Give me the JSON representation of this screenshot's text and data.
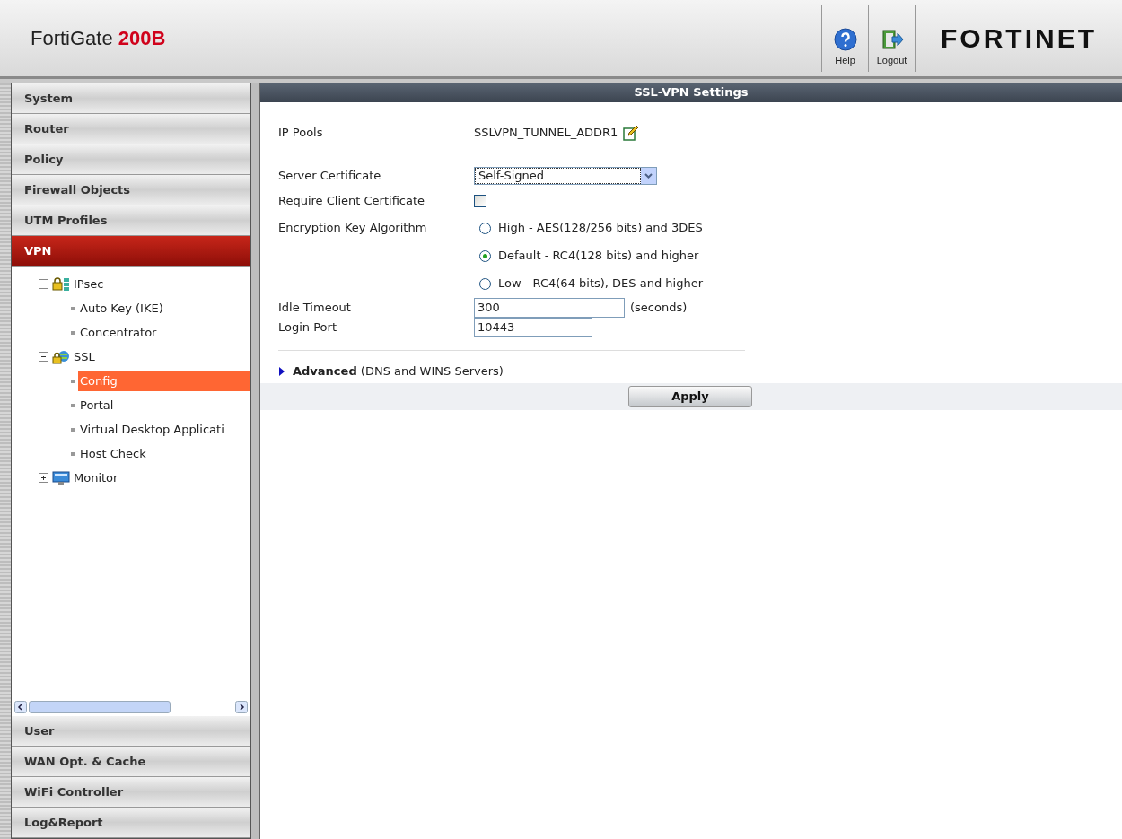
{
  "header": {
    "product": "FortiGate",
    "model": "200B",
    "buttons": [
      {
        "kind": "help",
        "label": "Help"
      },
      {
        "kind": "logout",
        "label": "Logout"
      }
    ],
    "logo": "FORTINET"
  },
  "sidebar": {
    "top_items": [
      {
        "label": "System",
        "selected": false
      },
      {
        "label": "Router",
        "selected": false
      },
      {
        "label": "Policy",
        "selected": false
      },
      {
        "label": "Firewall Objects",
        "selected": false
      },
      {
        "label": "UTM Profiles",
        "selected": false
      },
      {
        "label": "VPN",
        "selected": true
      }
    ],
    "tree": [
      {
        "label": "IPsec",
        "kind": "ipsec",
        "expanded": true,
        "children": [
          {
            "label": "Auto Key (IKE)",
            "selected": false
          },
          {
            "label": "Concentrator",
            "selected": false
          }
        ]
      },
      {
        "label": "SSL",
        "kind": "ssl",
        "expanded": true,
        "children": [
          {
            "label": "Config",
            "selected": true
          },
          {
            "label": "Portal",
            "selected": false
          },
          {
            "label": "Virtual Desktop Applicati",
            "selected": false
          },
          {
            "label": "Host Check",
            "selected": false
          }
        ]
      },
      {
        "label": "Monitor",
        "kind": "monitor",
        "expanded": false
      }
    ],
    "bottom_items": [
      {
        "label": "User",
        "selected": false
      },
      {
        "label": "WAN Opt. & Cache",
        "selected": false
      },
      {
        "label": "WiFi Controller",
        "selected": false
      },
      {
        "label": "Log&Report",
        "selected": false
      }
    ]
  },
  "panel": {
    "title": "SSL-VPN Settings",
    "ip_pools": {
      "label": "IP Pools",
      "value": "SSLVPN_TUNNEL_ADDR1"
    },
    "server_certificate": {
      "label": "Server Certificate",
      "value": "Self-Signed"
    },
    "require_client_certificate": {
      "label": "Require Client Certificate",
      "checked": false
    },
    "encryption": {
      "label": "Encryption Key Algorithm",
      "options": [
        {
          "label": "High - AES(128/256 bits) and 3DES",
          "selected": false
        },
        {
          "label": "Default - RC4(128 bits) and higher",
          "selected": true
        },
        {
          "label": "Low - RC4(64 bits), DES and higher",
          "selected": false
        }
      ]
    },
    "idle_timeout": {
      "label": "Idle Timeout",
      "value": "300",
      "unit": "(seconds)"
    },
    "login_port": {
      "label": "Login Port",
      "value": "10443"
    },
    "advanced": {
      "label": "**Advanced** (DNS and WINS Servers)",
      "expanded": false
    },
    "apply": "Apply"
  }
}
